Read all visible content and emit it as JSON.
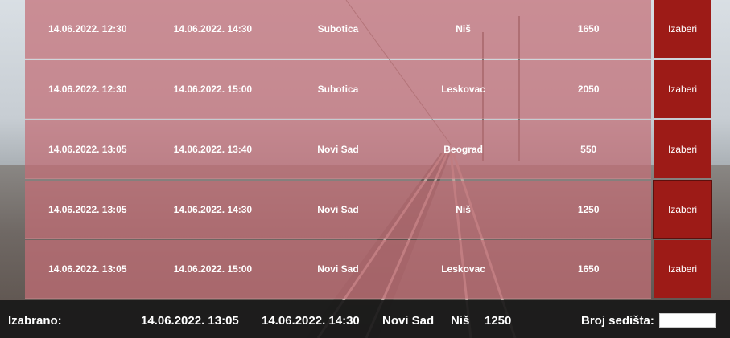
{
  "rows": [
    {
      "departure": "14.06.2022. 12:30",
      "arrival": "14.06.2022. 14:30",
      "from": "Subotica",
      "to": "Niš",
      "price": "1650",
      "action": "Izaberi"
    },
    {
      "departure": "14.06.2022. 12:30",
      "arrival": "14.06.2022. 15:00",
      "from": "Subotica",
      "to": "Leskovac",
      "price": "2050",
      "action": "Izaberi"
    },
    {
      "departure": "14.06.2022. 13:05",
      "arrival": "14.06.2022. 13:40",
      "from": "Novi Sad",
      "to": "Beograd",
      "price": "550",
      "action": "Izaberi"
    },
    {
      "departure": "14.06.2022. 13:05",
      "arrival": "14.06.2022. 14:30",
      "from": "Novi Sad",
      "to": "Niš",
      "price": "1250",
      "action": "Izaberi"
    },
    {
      "departure": "14.06.2022. 13:05",
      "arrival": "14.06.2022. 15:00",
      "from": "Novi Sad",
      "to": "Leskovac",
      "price": "1650",
      "action": "Izaberi"
    }
  ],
  "selection": {
    "label": "Izabrano:",
    "departure": "14.06.2022. 13:05",
    "arrival": "14.06.2022. 14:30",
    "from": "Novi Sad",
    "to": "Niš",
    "price": "1250",
    "seats_label": "Broj sedišta:",
    "seats_value": ""
  },
  "colors": {
    "row_tint": "#c46e76",
    "button": "#9d1b17",
    "footer": "#181818"
  }
}
